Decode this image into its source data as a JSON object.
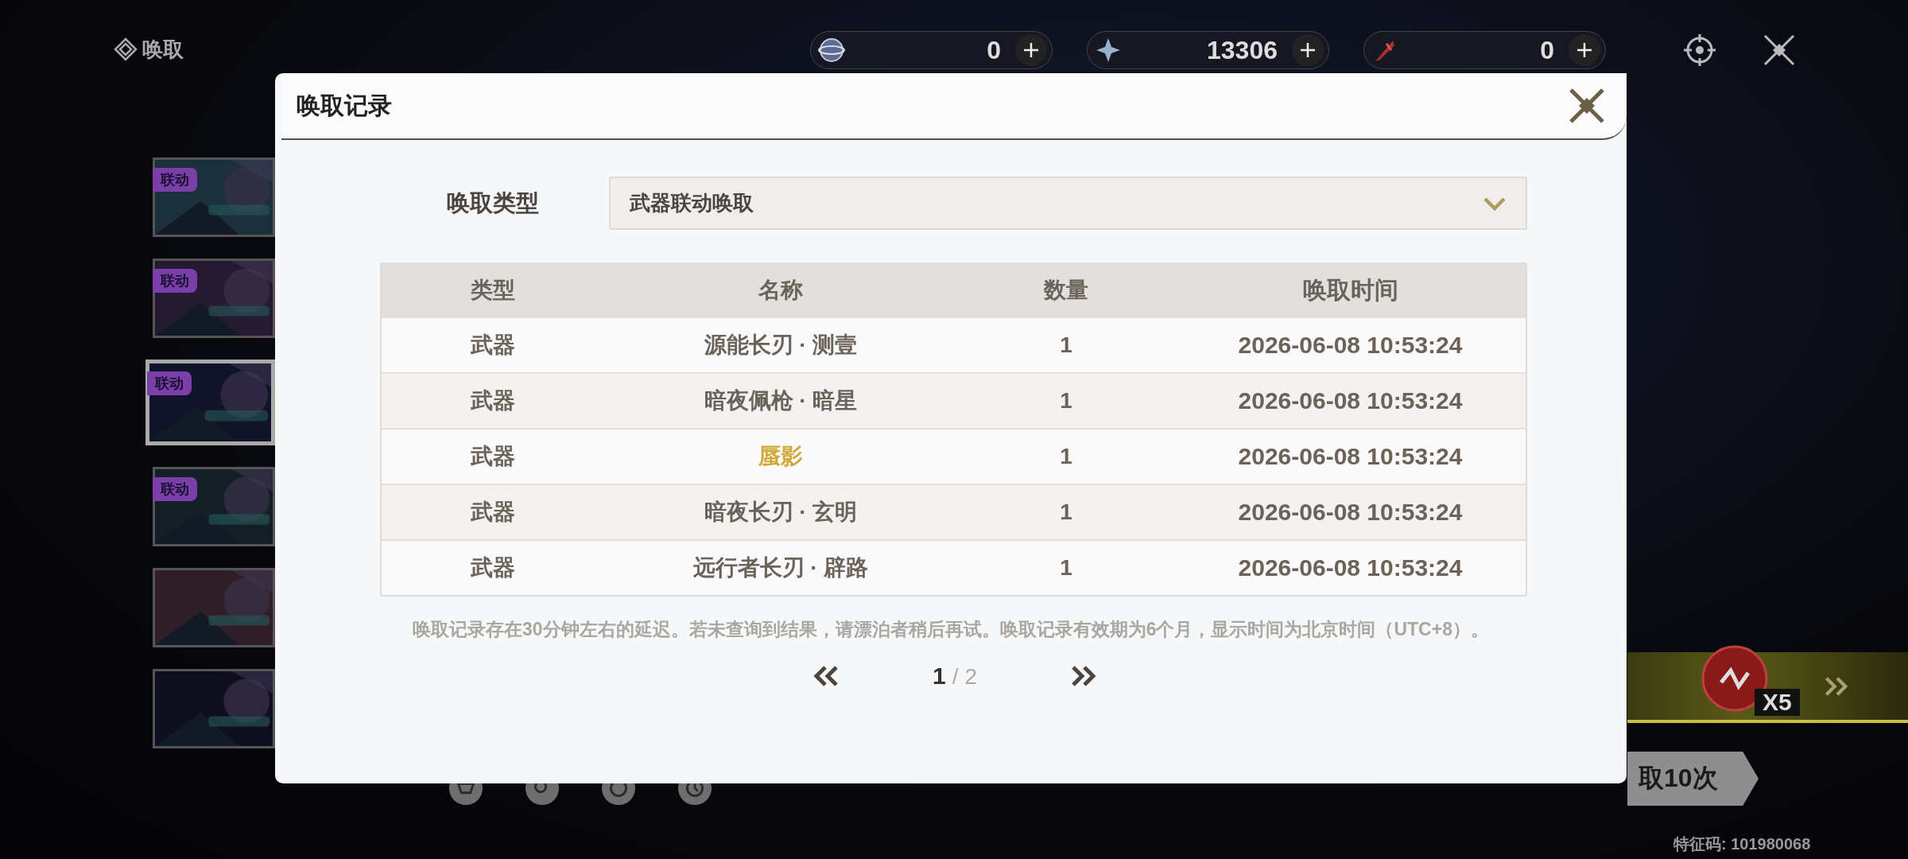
{
  "header": {
    "title": "唤取"
  },
  "currencies": [
    {
      "kind": "orb",
      "value": "0"
    },
    {
      "kind": "star",
      "value": "13306"
    },
    {
      "kind": "feather",
      "value": "0"
    }
  ],
  "banners": [
    {
      "tag": "联动",
      "selected": false
    },
    {
      "tag": "联动",
      "selected": false
    },
    {
      "tag": "联动",
      "selected": true
    },
    {
      "tag": "联动",
      "selected": false
    },
    {
      "selected": false
    },
    {
      "selected": false
    }
  ],
  "modal": {
    "title": "唤取记录",
    "filter_label": "唤取类型",
    "filter_value": "武器联动唤取",
    "columns": [
      "类型",
      "名称",
      "数量",
      "唤取时间"
    ],
    "rows": [
      {
        "type": "武器",
        "name": "源能长刃 · 测壹",
        "count": "1",
        "time": "2026-06-08 10:53:24",
        "color": "#6b635a"
      },
      {
        "type": "武器",
        "name": "暗夜佩枪 · 暗星",
        "count": "1",
        "time": "2026-06-08 10:53:24",
        "color": "#6b635a"
      },
      {
        "type": "武器",
        "name": "蜃影",
        "count": "1",
        "time": "2026-06-08 10:53:24",
        "color": "#d0a838"
      },
      {
        "type": "武器",
        "name": "暗夜长刃 · 玄明",
        "count": "1",
        "time": "2026-06-08 10:53:24",
        "color": "#6b635a"
      },
      {
        "type": "武器",
        "name": "远行者长刃 · 辟路",
        "count": "1",
        "time": "2026-06-08 10:53:24",
        "color": "#6b635a"
      }
    ],
    "note": "唤取记录存在30分钟左右的延迟。若未查询到结果，请漂泊者稍后再试。唤取记录有效期为6个月，显示时间为北京时间（UTC+8）。",
    "pagination": {
      "current": "1",
      "separator": "/",
      "total": "2"
    }
  },
  "bonus": {
    "count": "X5"
  },
  "pull_button": {
    "label": "取10次"
  },
  "footer_code": "特征码: 101980068"
}
